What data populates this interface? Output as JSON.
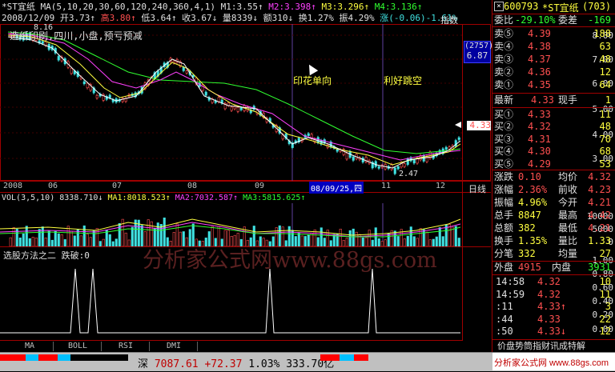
{
  "header": {
    "stock": "*ST宜纸",
    "ma_spec": "MA(5,10,20,30,60,120,240,360,4,1)",
    "m1": "M1:3.55↑",
    "m2": "M2:3.398↑",
    "m3": "M3:3.296↑",
    "m4": "M4:3.136↑",
    "date_line": "2008/12/09",
    "open": "开3.73↑",
    "high": "高3.80↑",
    "low": "低3.64↑",
    "close": "收3.67↓",
    "volume": "量8339↓",
    "amount": "额310↓",
    "turnover": "换1.27%",
    "amplitude": "振4.29%",
    "change": "涨(-0.06)-1.61%",
    "index_btn": "指数"
  },
  "chart": {
    "title": "造纸印刷,四川,小盘,预亏预减",
    "annotation1": "印花单向",
    "annotation2": "利好跳空",
    "max_label": "8.16",
    "min_label": "2.47",
    "badge_top": "(2757)",
    "badge_price": "6.87",
    "current_price": "4.33",
    "y_axis": [
      "8.00",
      "7.00",
      "6.00",
      "5.00",
      "4.00",
      "3.00"
    ],
    "date_axis": [
      "2008",
      "06",
      "07",
      "08",
      "09",
      "08/09/25,四",
      "11",
      "12"
    ],
    "period": "日线"
  },
  "vol": {
    "label": "VOL(3,5,10)",
    "value": "8338.710↓",
    "ma1": "MA1:8018.523↑",
    "ma2": "MA2:7032.587↑",
    "ma3": "MA3:5815.625↑",
    "y_axis": [
      "10000",
      "5000",
      "0"
    ]
  },
  "sel": {
    "label": "选股方法之二",
    "param": "跌破:0",
    "watermark": "分析家公式网www.88gs.com",
    "y_axis": [
      "1.00",
      "0.80",
      "0.60",
      "0.40",
      "0.20",
      "0.00"
    ]
  },
  "tabs": [
    "MA",
    "BOLL",
    "RSI",
    "DMI"
  ],
  "footer": {
    "market": "深",
    "index": "7087.61",
    "chg": "+72.37",
    "pct": "1.03%",
    "amount": "333.70亿",
    "brand": "分析家公式网 www.88gs.com"
  },
  "quote": {
    "code": "600793",
    "name": "*ST宜纸",
    "num": "(703)",
    "weibi_label": "委比",
    "weibi": "-29.10%",
    "weicha_label": "委差",
    "weicha": "-169",
    "sell": [
      {
        "label": "卖⑤",
        "price": "4.39",
        "vol": "188"
      },
      {
        "label": "卖④",
        "price": "4.38",
        "vol": "63"
      },
      {
        "label": "卖③",
        "price": "4.37",
        "vol": "48"
      },
      {
        "label": "卖②",
        "price": "4.36",
        "vol": "12"
      },
      {
        "label": "卖①",
        "price": "4.35",
        "vol": "64"
      }
    ],
    "latest_label": "最新",
    "latest": "4.33",
    "hand_label": "现手",
    "hand": "1",
    "buy": [
      {
        "label": "买①",
        "price": "4.33",
        "vol": "11"
      },
      {
        "label": "买②",
        "price": "4.32",
        "vol": "48"
      },
      {
        "label": "买③",
        "price": "4.31",
        "vol": "70"
      },
      {
        "label": "买④",
        "price": "4.30",
        "vol": "68"
      },
      {
        "label": "买⑤",
        "price": "4.29",
        "vol": "53"
      }
    ],
    "stats": [
      {
        "l1": "涨跌",
        "v1": "0.10",
        "l2": "均价",
        "v2": "4.32"
      },
      {
        "l1": "涨幅",
        "v1": "2.36%",
        "l2": "前收",
        "v2": "4.23"
      },
      {
        "l1": "振幅",
        "v1": "4.96%",
        "l2": "今开",
        "v2": "4.21"
      },
      {
        "l1": "总手",
        "v1": "8847",
        "l2": "最高",
        "v2": "4.42"
      },
      {
        "l1": "总额",
        "v1": "382",
        "l2": "最低",
        "v2": "4.21"
      },
      {
        "l1": "换手",
        "v1": "1.35%",
        "l2": "量比",
        "v2": "1.33"
      },
      {
        "l1": "分笔",
        "v1": "332",
        "l2": "均量",
        "v2": "27"
      }
    ],
    "waipan_label": "外盘",
    "waipan": "4915",
    "neipan_label": "内盘",
    "neipan": "3931",
    "ticks": [
      {
        "t": "14:58",
        "p": "4.32",
        "v": "10"
      },
      {
        "t": "14:59",
        "p": "4.32",
        "v": "11"
      },
      {
        "t": ":11",
        "p": "4.33↑",
        "v": "3"
      },
      {
        "t": ":44",
        "p": "4.33",
        "v": "22"
      },
      {
        "t": ":50",
        "p": "4.33↓",
        "v": "12"
      }
    ],
    "bottom_tab": "价盘势筒指财讯成特解"
  }
}
